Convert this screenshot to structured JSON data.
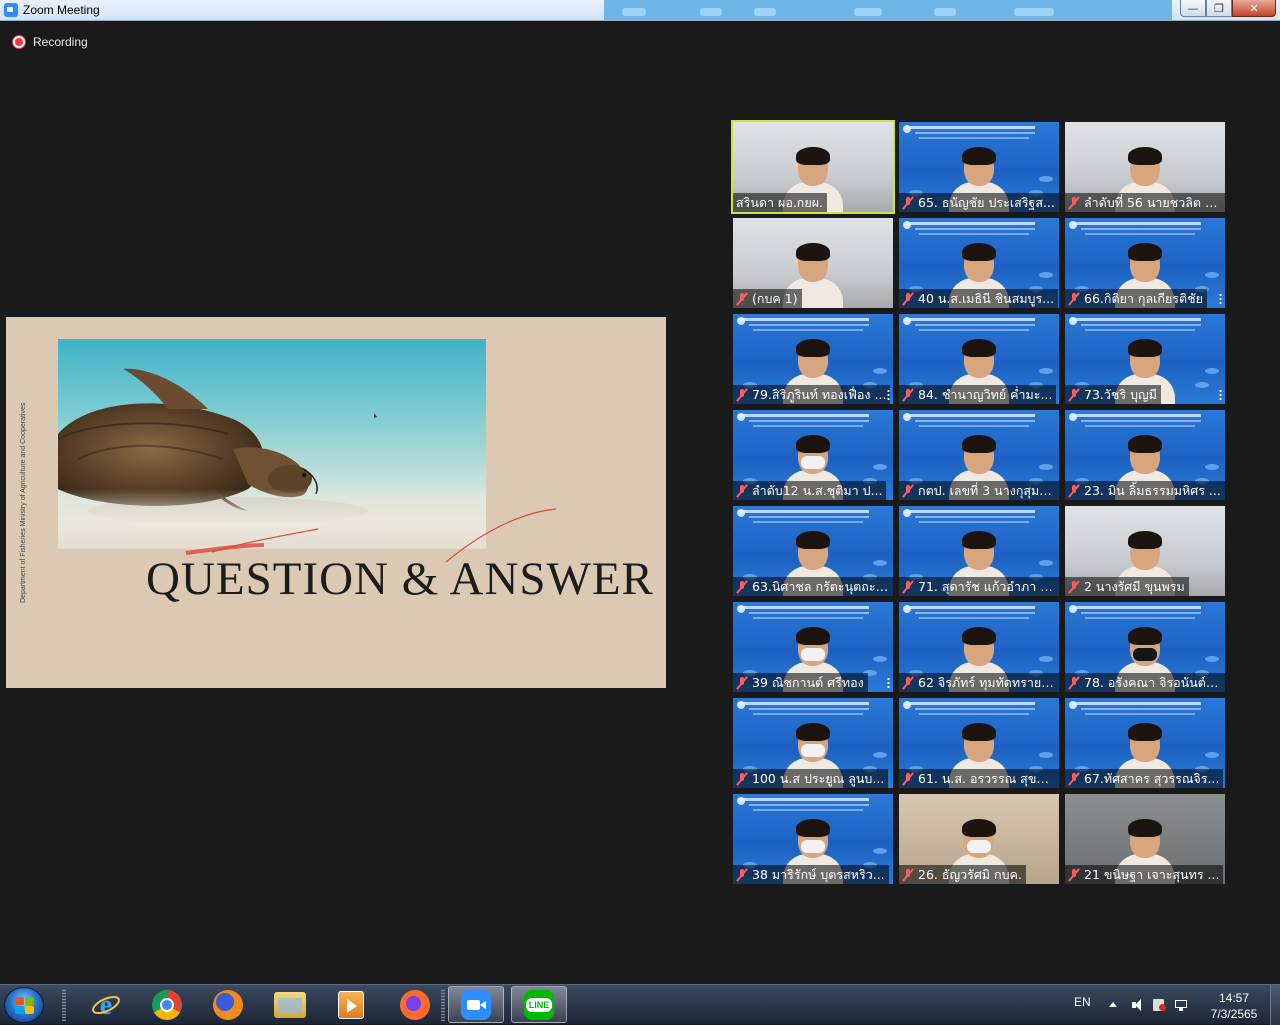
{
  "window": {
    "title": "Zoom Meeting"
  },
  "recording": {
    "label": "Recording"
  },
  "slide": {
    "title": "QUESTION & ANSWER",
    "vertical_text": "Department of Fisheries Ministry of Agriculture and Cooperatives"
  },
  "participants": [
    {
      "name": "สรินดา ผอ.กยผ.",
      "muted": false,
      "speaker": true,
      "bg": "office"
    },
    {
      "name": "65. ธนัญชัย ประเสริฐส...",
      "muted": true,
      "bg": "blue"
    },
    {
      "name": "ลำดับที่ 56 นายชวลิต เ...",
      "muted": true,
      "bg": "office"
    },
    {
      "name": "(กบค 1)",
      "muted": true,
      "bg": "office"
    },
    {
      "name": "40 น.ส.เมธินี ชินสมบูร...",
      "muted": true,
      "bg": "blue"
    },
    {
      "name": "66.กิติยา กุลเกียรติชัย",
      "muted": true,
      "bg": "blue"
    },
    {
      "name": "79.สิริภูรินท์ ทองเฟื่อง ...",
      "muted": true,
      "bg": "blue"
    },
    {
      "name": "84. ชำนาญวิทย์ ค่ำมะ...",
      "muted": true,
      "bg": "blue"
    },
    {
      "name": "73.วัชริ บุญมี",
      "muted": true,
      "bg": "blue"
    },
    {
      "name": "ลำดับ12 น.ส.ชุติมา ป...",
      "muted": true,
      "bg": "blue"
    },
    {
      "name": "กตป. เลขที่ 3 นางกุสุมา...",
      "muted": true,
      "bg": "blue"
    },
    {
      "name": "23. มิน ลิ้มธรรมมหิศร ...",
      "muted": true,
      "bg": "blue"
    },
    {
      "name": "63.นิศาชล กรัตะนุตถะ ...",
      "muted": true,
      "bg": "blue"
    },
    {
      "name": "71. สุดารัช แก้วอำภา ส...",
      "muted": true,
      "bg": "blue"
    },
    {
      "name": "2 นางรัศมี ขุนพรม",
      "muted": true,
      "bg": "office"
    },
    {
      "name": "39 ณิชกานต์ ศรีทอง",
      "muted": true,
      "bg": "blue"
    },
    {
      "name": "62 จิรภัทร์ ทุมทัดทราย ...",
      "muted": true,
      "bg": "blue"
    },
    {
      "name": "78. อรังคณา จิรอนันต์เ...",
      "muted": true,
      "bg": "blue"
    },
    {
      "name": "100 น.ส ประยูณ ลูนบ...",
      "muted": true,
      "bg": "blue"
    },
    {
      "name": "61. น.ส. อรวรรณ สุขดิ...",
      "muted": true,
      "bg": "blue"
    },
    {
      "name": "67.ทัศสาคร สุวรรณจิร...",
      "muted": true,
      "bg": "blue"
    },
    {
      "name": "38 มาริรักษ์ บุตรสหริว...",
      "muted": true,
      "bg": "blue"
    },
    {
      "name": "26. ธัญวรัศมิ กบค.",
      "muted": true,
      "bg": "office"
    },
    {
      "name": "21 ขนิษฐา เจาะสุนทร ...",
      "muted": true,
      "bg": "office"
    }
  ],
  "taskbar": {
    "apps": [
      {
        "name": "internet-explorer"
      },
      {
        "name": "chrome"
      },
      {
        "name": "firefox"
      },
      {
        "name": "file-explorer"
      },
      {
        "name": "media-player"
      },
      {
        "name": "firefox-2"
      },
      {
        "name": "zoom",
        "active": true
      },
      {
        "name": "line",
        "label": "LINE"
      }
    ],
    "lang": "EN",
    "time": "14:57",
    "date": "7/3/2565"
  }
}
